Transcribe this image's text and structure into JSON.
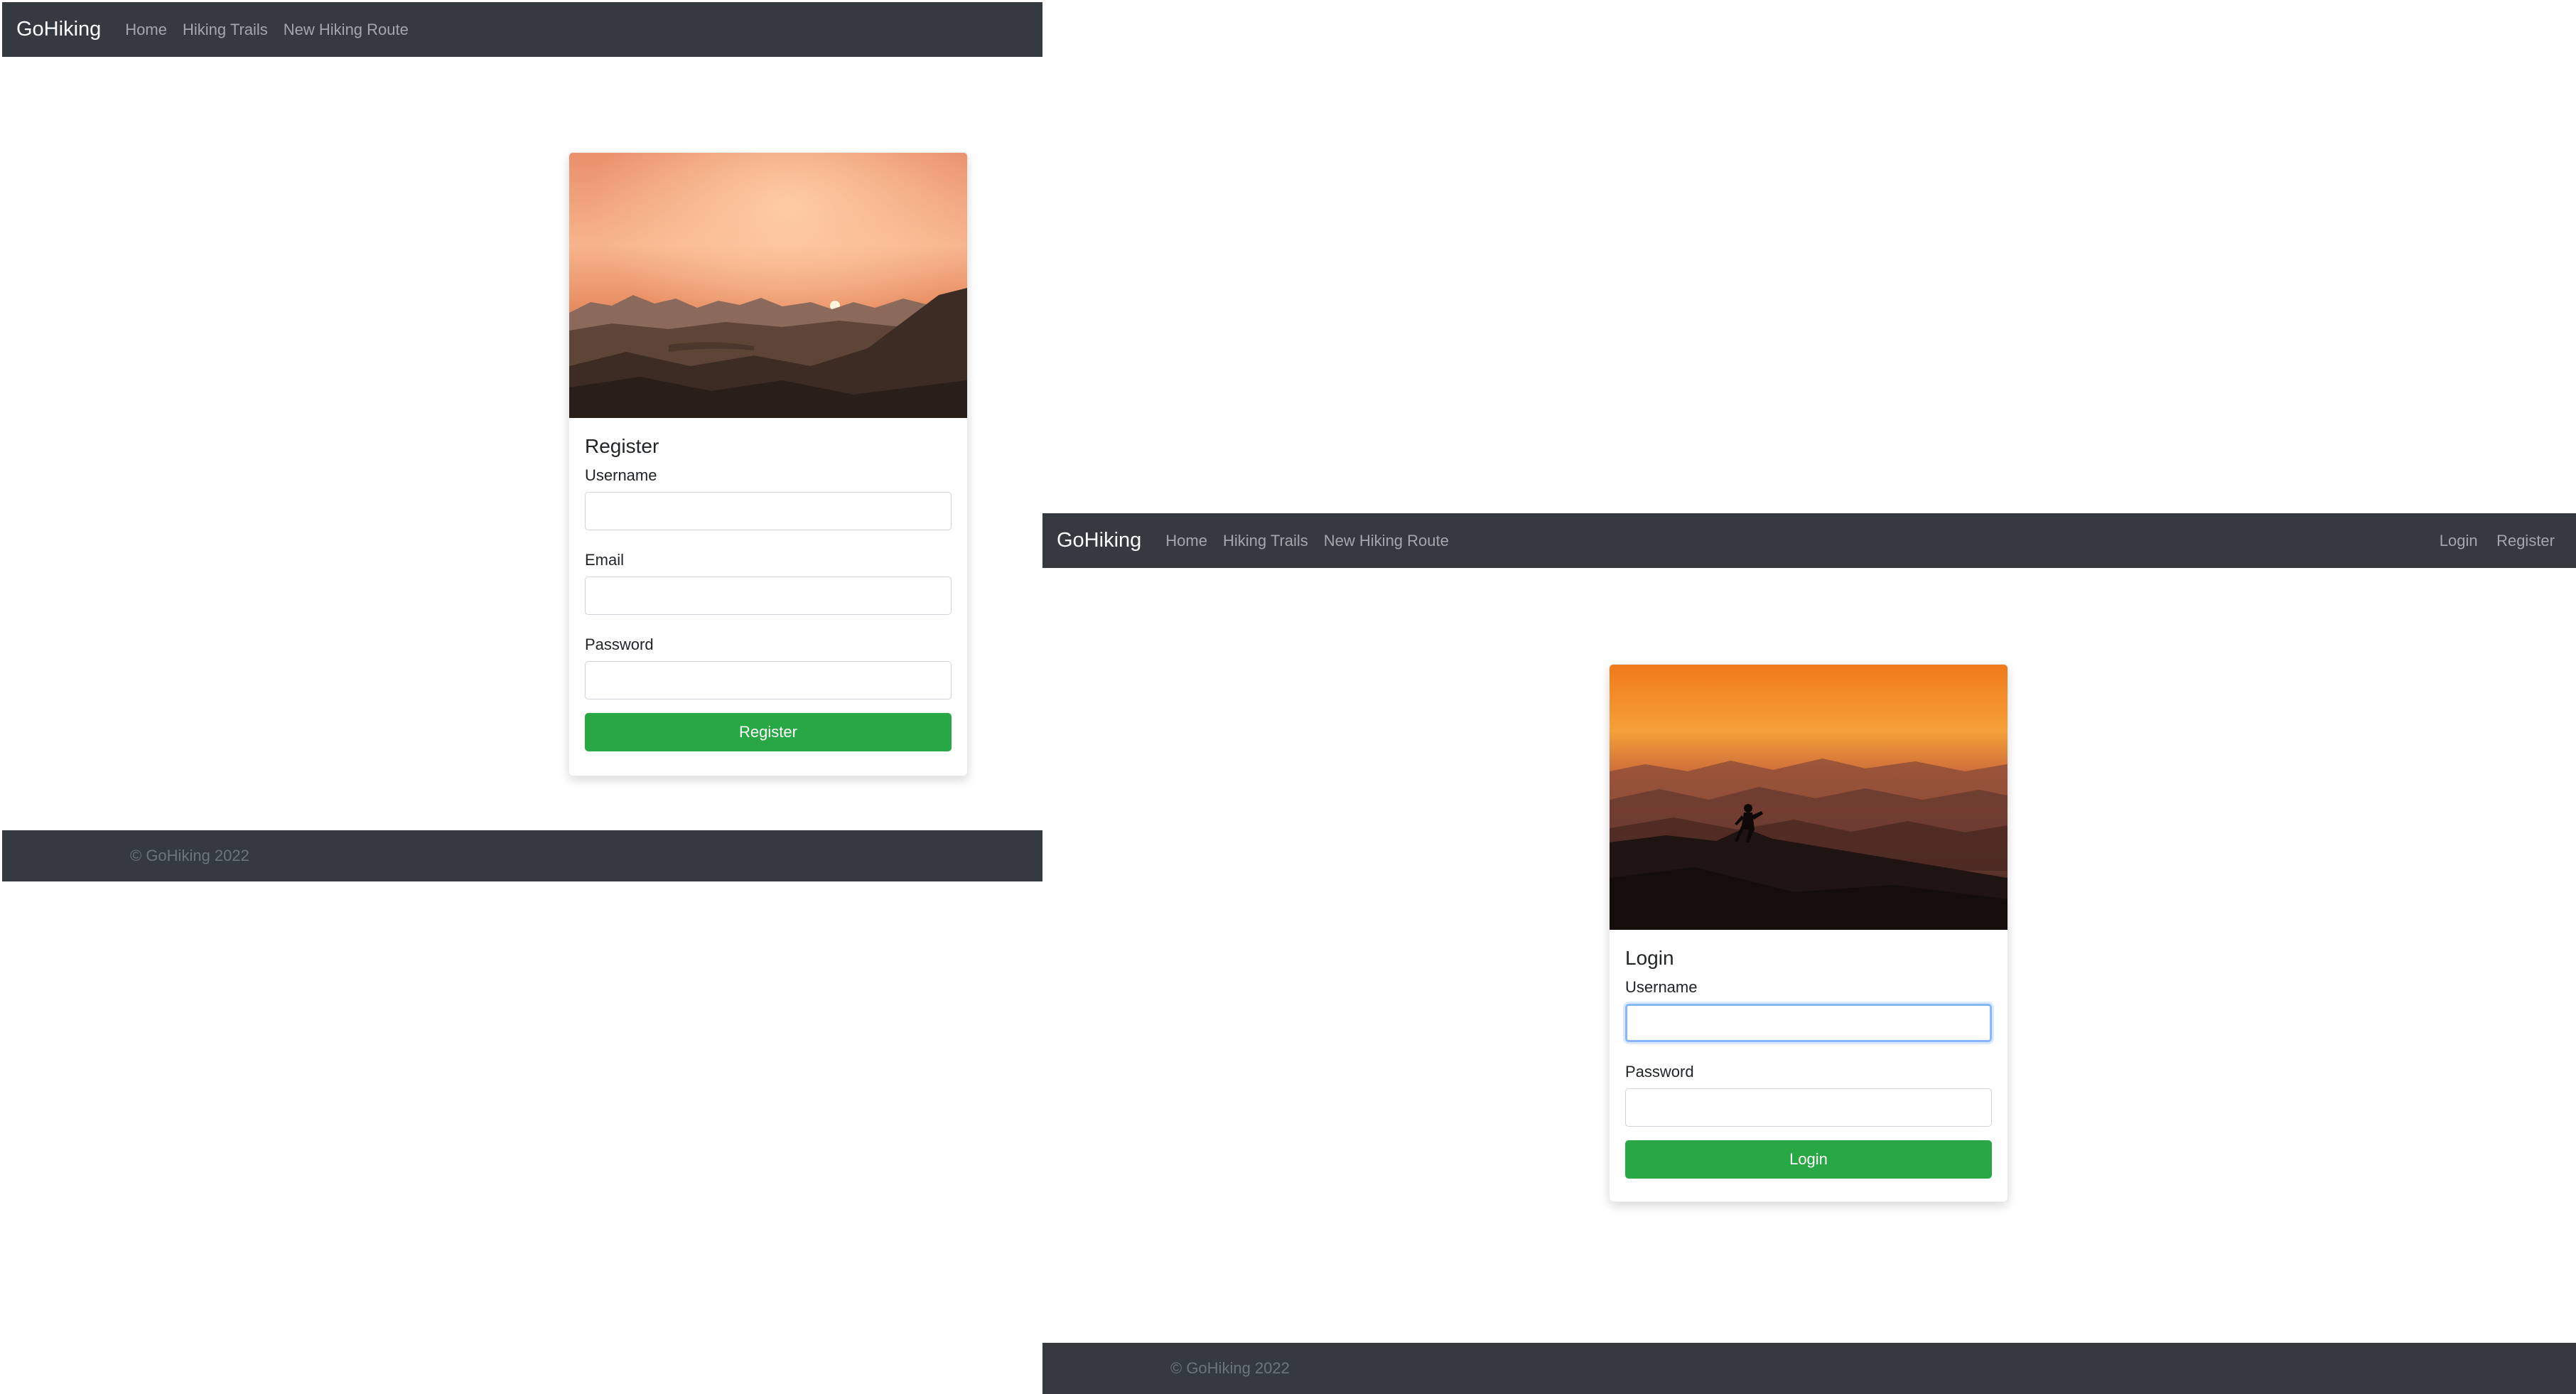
{
  "nav": {
    "brand": "GoHiking",
    "links": [
      "Home",
      "Hiking Trails",
      "New Hiking Route"
    ],
    "right_links": [
      "Login",
      "Register"
    ]
  },
  "register": {
    "title": "Register",
    "fields": [
      {
        "label": "Username",
        "value": ""
      },
      {
        "label": "Email",
        "value": ""
      },
      {
        "label": "Password",
        "value": ""
      }
    ],
    "button": "Register"
  },
  "login": {
    "title": "Login",
    "fields": [
      {
        "label": "Username",
        "value": ""
      },
      {
        "label": "Password",
        "value": ""
      }
    ],
    "button": "Login"
  },
  "footer": {
    "text": "© GoHiking 2022"
  },
  "colors": {
    "navbar": "#343a40",
    "button": "#28a745",
    "focus": "#86b7fe"
  }
}
